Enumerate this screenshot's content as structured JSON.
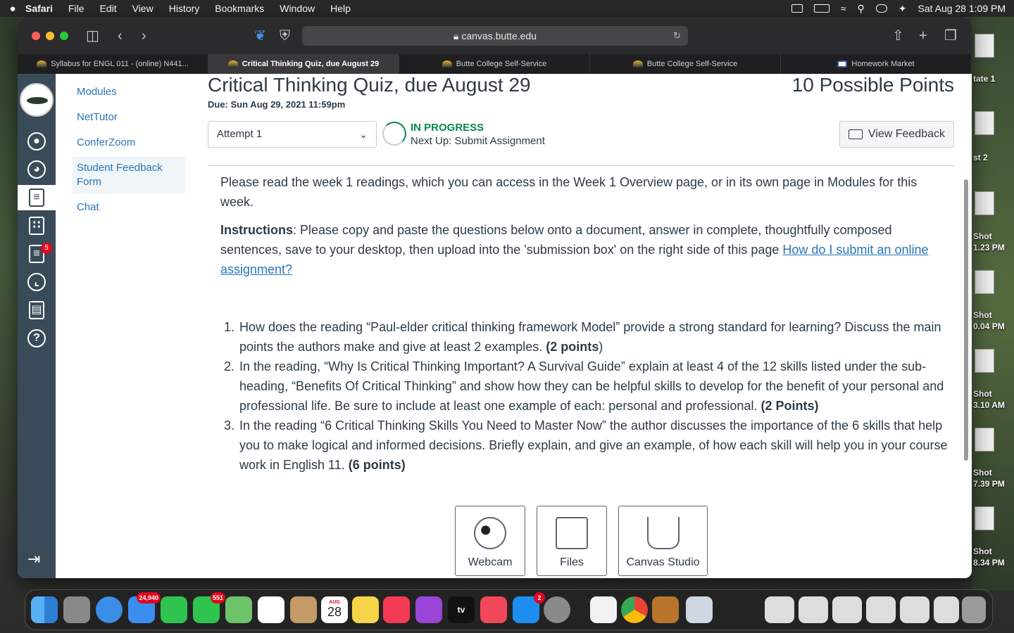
{
  "menubar": {
    "app": "Safari",
    "menus": [
      "File",
      "Edit",
      "View",
      "History",
      "Bookmarks",
      "Window",
      "Help"
    ],
    "datetime": "Sat Aug 28  1:09 PM"
  },
  "browser": {
    "url": "canvas.butte.edu",
    "tabs": [
      {
        "label": "Syllabus for ENGL 011 - (online) N441..."
      },
      {
        "label": "Critical Thinking Quiz, due August 29"
      },
      {
        "label": "Butte College Self-Service"
      },
      {
        "label": "Butte College Self-Service"
      },
      {
        "label": "Homework Market"
      }
    ]
  },
  "desktop": {
    "items": [
      "tate 1",
      "st 2",
      "Shot\n1.23 PM",
      "Shot\n0.04 PM",
      "Shot\n3.10 AM",
      "Shot\n7.39 PM",
      "Shot\n8.34 PM"
    ]
  },
  "global_nav": {
    "inbox_badge": "5"
  },
  "course_nav": {
    "items": [
      "Modules",
      "NetTutor",
      "ConferZoom",
      "Student Feedback Form",
      "Chat"
    ]
  },
  "assignment": {
    "title": "Critical Thinking Quiz, due August 29",
    "points": "10 Possible Points",
    "due": "Due: Sun Aug 29, 2021 11:59pm",
    "attempt": "Attempt 1",
    "status": "IN PROGRESS",
    "next_up": "Next Up: Submit Assignment",
    "view_feedback": "View Feedback",
    "intro": "Please read the week 1 readings, which you can access in the Week 1 Overview page, or in its own page in Modules for this week.",
    "instructions_label": "Instructions",
    "instructions_text": ":  Please copy and paste the questions below onto a document, answer in complete, thoughtfully composed sentences, save to your desktop, then upload into the 'submission box' on the right side of this page  ",
    "instructions_link": "How do I submit an online assignment?",
    "questions": [
      {
        "text": "How does the reading “Paul-elder critical thinking framework Model” provide a strong standard for learning? Discuss the main points the authors make and give at least 2 examples. ",
        "points": "(2 points",
        "tail": ")"
      },
      {
        "text": " In the reading, “Why Is Critical Thinking Important? A Survival Guide” explain at least 4 of the 12 skills listed under the sub-heading, “Benefits Of Critical Thinking” and show how they can be helpful skills to develop for the benefit of your personal and professional life. Be sure to include at least one example of each: personal and professional.  ",
        "points": "(2 Points)",
        "tail": ""
      },
      {
        "text": "In the reading “6 Critical Thinking Skills You Need to Master Now” the author discusses the importance of the 6 skills that help you to make logical and informed decisions. Briefly explain, and give an example, of how each skill will help you in your course work in English 11. ",
        "points": "(6 points)",
        "tail": ""
      }
    ],
    "submission_tools": [
      "Webcam",
      "Files",
      "Canvas Studio"
    ]
  },
  "dock": {
    "mail_badge": "24,940",
    "messages_badge": "551",
    "appstore_badge": "2",
    "calendar_month": "AUG",
    "calendar_day": "28",
    "tv_label": "tv"
  }
}
